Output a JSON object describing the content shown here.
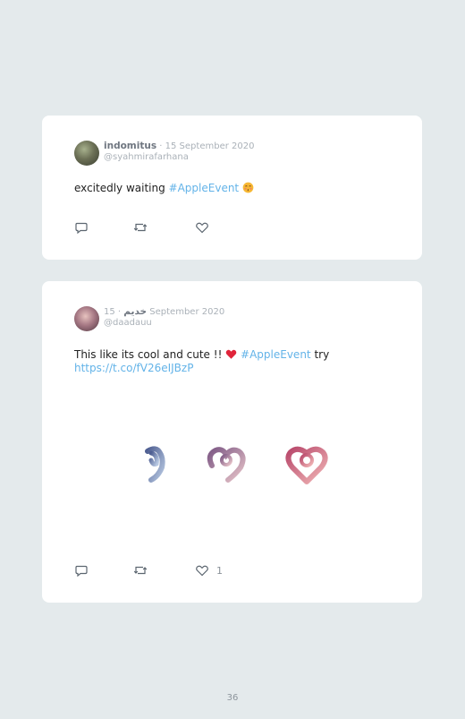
{
  "tweets": [
    {
      "name": "indomitus",
      "date": "15 September 2020",
      "handle": "@syahmirafarhana",
      "text": "excitedly waiting",
      "hashtag": "#AppleEvent",
      "emoji_icon": "kissing-face-emoji",
      "like_count": ""
    },
    {
      "name": "خديم",
      "date": "15 September 2020",
      "handle": "@daadauu",
      "text": "This like its cool and cute !!",
      "heart_icon": "red-heart-emoji",
      "hashtag": "#AppleEvent",
      "text_after": "try",
      "link": "https://t.co/fV26eIJBzP",
      "media": "three-heart-shapes-image",
      "like_count": "1"
    }
  ],
  "separator": "·",
  "page_number": "36",
  "colors": {
    "background": "#e4eaec",
    "card": "#ffffff",
    "link": "#63b3e8",
    "muted": "#aab1b8"
  },
  "icons": [
    "reply-icon",
    "retweet-icon",
    "like-icon"
  ]
}
